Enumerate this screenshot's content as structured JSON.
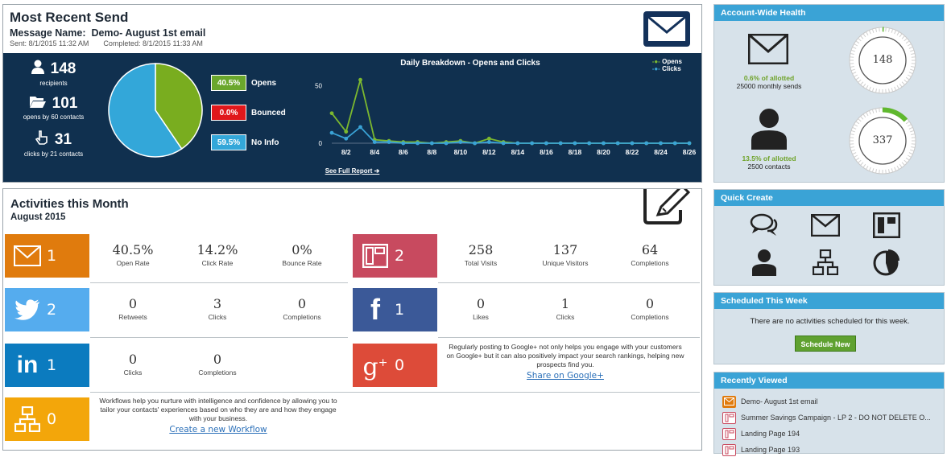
{
  "recent_send": {
    "title": "Most Recent Send",
    "message_label": "Message Name:",
    "message_name": "Demo- August 1st email",
    "sent": "Sent:  8/1/2015 11:32 AM",
    "completed": "Completed:  8/1/2015 11:33 AM",
    "recipients_count": "148",
    "recipients_label": "recipients",
    "opens_count": "101",
    "opens_label": "opens by 60 contacts",
    "clicks_count": "31",
    "clicks_label": "clicks by 21 contacts",
    "legend": [
      {
        "pct": "40.5%",
        "label": "Opens",
        "color": "#6aa72c"
      },
      {
        "pct": "0.0%",
        "label": "Bounced",
        "color": "#e0171b"
      },
      {
        "pct": "59.5%",
        "label": "No Info",
        "color": "#33a7d9"
      }
    ],
    "full_report": "See Full Report ➔"
  },
  "pie_chart": {
    "type": "pie",
    "slices": [
      {
        "label": "Opens",
        "value": 40.5,
        "color": "#79ad1f"
      },
      {
        "label": "Bounced",
        "value": 0.0,
        "color": "#e0171b"
      },
      {
        "label": "No Info",
        "value": 59.5,
        "color": "#33a7d9"
      }
    ]
  },
  "chart_data": {
    "type": "line",
    "title": "Daily Breakdown - Opens and Clicks",
    "x": [
      "8/1",
      "8/2",
      "8/3",
      "8/4",
      "8/5",
      "8/6",
      "8/7",
      "8/8",
      "8/9",
      "8/10",
      "8/11",
      "8/12",
      "8/13",
      "8/14",
      "8/15",
      "8/16",
      "8/17",
      "8/18",
      "8/19",
      "8/20",
      "8/21",
      "8/22",
      "8/23",
      "8/24",
      "8/25",
      "8/26"
    ],
    "tick_labels": [
      "8/2",
      "8/4",
      "8/6",
      "8/8",
      "8/10",
      "8/12",
      "8/14",
      "8/16",
      "8/18",
      "8/20",
      "8/22",
      "8/24",
      "8/26"
    ],
    "series": [
      {
        "name": "Opens",
        "color": "#7cb82f",
        "values": [
          26,
          10,
          55,
          3,
          2,
          1,
          1,
          0,
          1,
          2,
          0,
          4,
          1,
          0,
          0,
          0,
          0,
          0,
          0,
          0,
          0,
          0,
          0,
          0,
          0,
          0
        ]
      },
      {
        "name": "Clicks",
        "color": "#3aa3d6",
        "values": [
          9,
          4,
          14,
          1,
          1,
          0,
          0,
          0,
          0,
          1,
          0,
          1,
          0,
          0,
          0,
          0,
          0,
          0,
          0,
          0,
          0,
          0,
          0,
          0,
          0,
          0
        ]
      }
    ],
    "yticks": [
      0,
      50
    ],
    "ylim": [
      0,
      60
    ]
  },
  "activities": {
    "title": "Activities this Month",
    "month": "August 2015",
    "email": {
      "count": "1",
      "metrics": [
        {
          "v": "40.5%",
          "l": "Open Rate"
        },
        {
          "v": "14.2%",
          "l": "Click Rate"
        },
        {
          "v": "0%",
          "l": "Bounce Rate"
        }
      ]
    },
    "landing": {
      "count": "2",
      "metrics": [
        {
          "v": "258",
          "l": "Total Visits"
        },
        {
          "v": "137",
          "l": "Unique Visitors"
        },
        {
          "v": "64",
          "l": "Completions"
        }
      ]
    },
    "twitter": {
      "count": "2",
      "metrics": [
        {
          "v": "0",
          "l": "Retweets"
        },
        {
          "v": "3",
          "l": "Clicks"
        },
        {
          "v": "0",
          "l": "Completions"
        }
      ]
    },
    "facebook": {
      "count": "1",
      "metrics": [
        {
          "v": "0",
          "l": "Likes"
        },
        {
          "v": "1",
          "l": "Clicks"
        },
        {
          "v": "0",
          "l": "Completions"
        }
      ]
    },
    "linkedin": {
      "count": "1",
      "metrics": [
        {
          "v": "0",
          "l": "Clicks"
        },
        {
          "v": "0",
          "l": "Completions"
        }
      ]
    },
    "google": {
      "count": "0",
      "note": "Regularly posting to Google+ not only helps you engage with your customers on Google+ but it can also positively impact your search rankings, helping new prospects find you.",
      "link": "Share on Google+"
    },
    "workflow": {
      "count": "0",
      "note": "Workflows help you nurture with intelligence and confidence by allowing you to tailor your contacts' experiences based on who they are and how they engage with your business.",
      "link": "Create a new Workflow"
    },
    "colors": {
      "email": "#e07b0d",
      "landing": "#c84a5f",
      "twitter": "#55acee",
      "facebook": "#3b5998",
      "linkedin": "#0b7bbf",
      "google": "#dd4b39",
      "workflow": "#f3a60a"
    }
  },
  "account_health": {
    "title": "Account-Wide Health",
    "sends_pct": "0.6% of allotted",
    "sends_label": "25000 monthly sends",
    "sends_value": "148",
    "sends_fraction": 0.006,
    "contacts_pct": "13.5% of allotted",
    "contacts_label": "2500 contacts",
    "contacts_value": "337",
    "contacts_fraction": 0.135
  },
  "quick_create": {
    "title": "Quick Create",
    "icons": [
      "chat-icon",
      "email-icon",
      "landing-page-icon",
      "contact-icon",
      "workflow-icon",
      "report-icon"
    ]
  },
  "scheduled": {
    "title": "Scheduled This Week",
    "message": "There are no activities scheduled for this week.",
    "button": "Schedule New"
  },
  "recently_viewed": {
    "title": "Recently Viewed",
    "items": [
      {
        "label": "Demo- August 1st email",
        "type": "email"
      },
      {
        "label": "Summer Savings Campaign - LP 2 - DO NOT DELETE O...",
        "type": "landing"
      },
      {
        "label": "Landing Page 194",
        "type": "landing"
      },
      {
        "label": "Landing Page 193",
        "type": "landing"
      }
    ]
  }
}
